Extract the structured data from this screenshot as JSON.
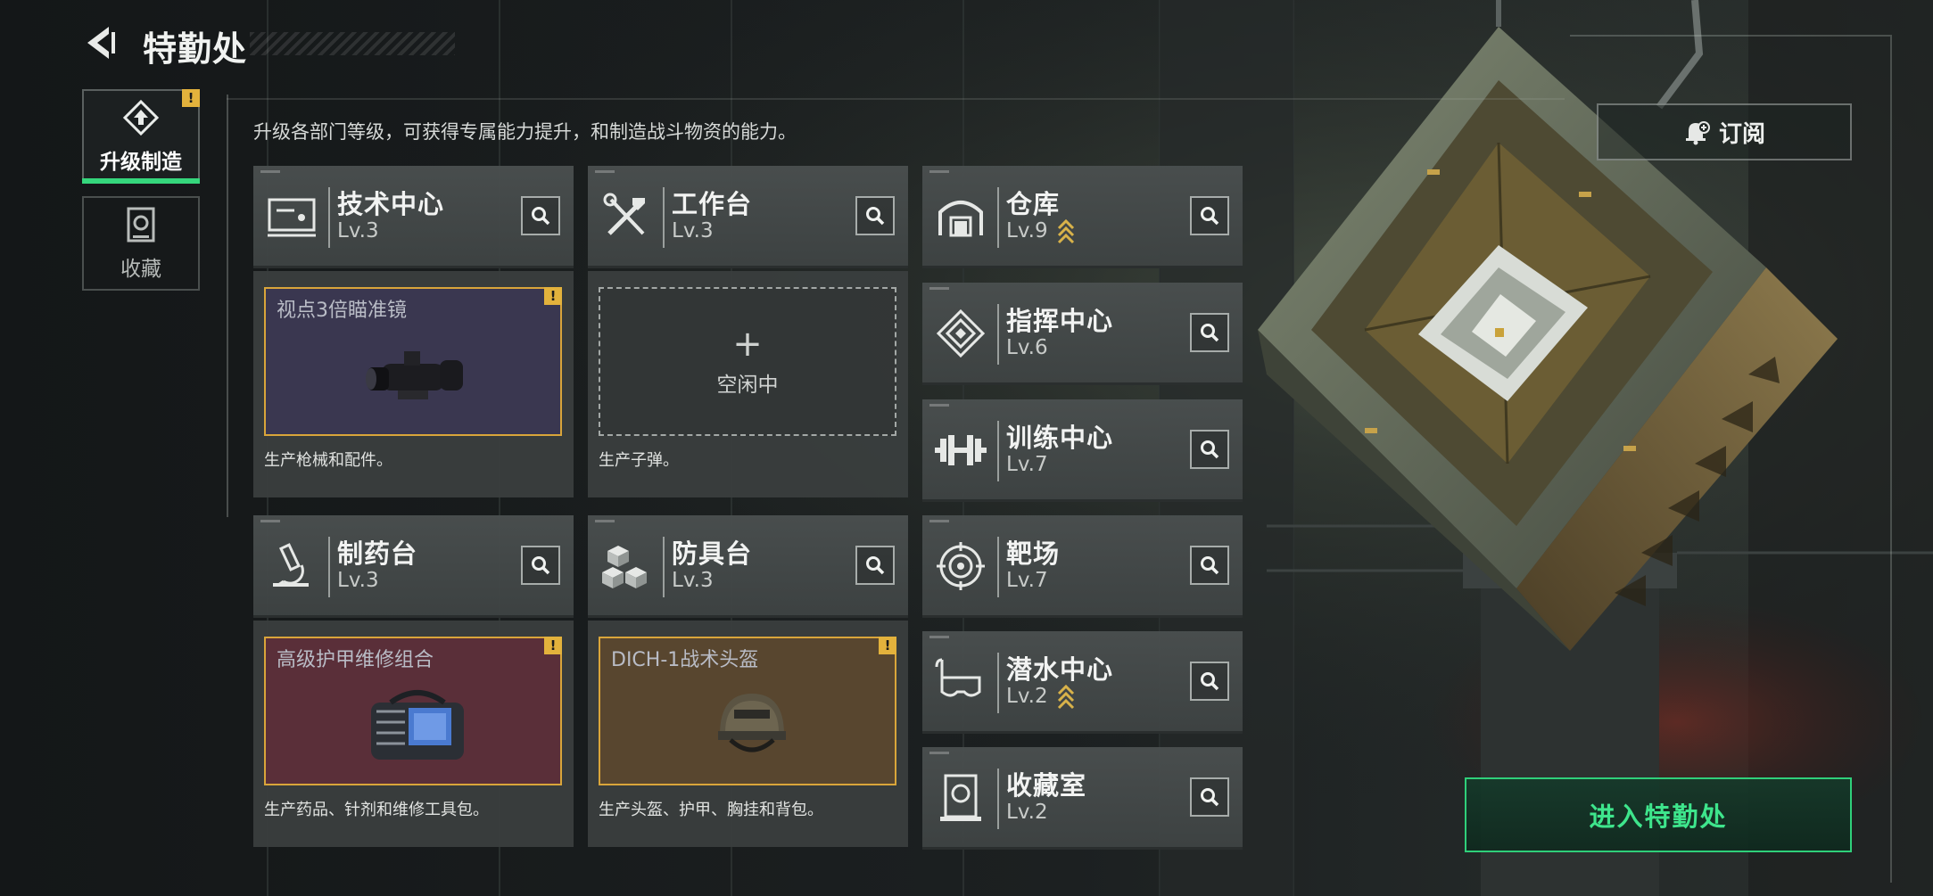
{
  "header": {
    "title": "特勤处"
  },
  "nav": {
    "tabs": [
      {
        "label": "升级制造",
        "active": true,
        "icon": "upgrade-icon",
        "warning": "!"
      },
      {
        "label": "收藏",
        "active": false,
        "icon": "collection-icon"
      }
    ]
  },
  "description": "升级各部门等级，可获得专属能力提升，和制造战斗物资的能力。",
  "facilities": {
    "tech_center": {
      "name": "技术中心",
      "level": "Lv.3",
      "icon": "terminal-icon",
      "slot": {
        "title": "视点3倍瞄准镜",
        "state": "item",
        "warning": "!",
        "art": "scope-icon"
      },
      "desc": "生产枪械和配件。"
    },
    "workbench": {
      "name": "工作台",
      "level": "Lv.3",
      "icon": "tools-icon",
      "slot": {
        "state": "idle",
        "plus": "+",
        "idle_label": "空闲中"
      },
      "desc": "生产子弹。"
    },
    "pharmacy": {
      "name": "制药台",
      "level": "Lv.3",
      "icon": "microscope-icon",
      "slot": {
        "title": "高级护甲维修组合",
        "state": "item",
        "warning": "!",
        "art": "repair-bag-icon"
      },
      "desc": "生产药品、针剂和维修工具包。"
    },
    "armory": {
      "name": "防具台",
      "level": "Lv.3",
      "icon": "cubes-icon",
      "slot": {
        "title": "DICH-1战术头盔",
        "state": "item",
        "warning": "!",
        "art": "helmet-icon"
      },
      "desc": "生产头盔、护甲、胸挂和背包。"
    },
    "warehouse": {
      "name": "仓库",
      "level": "Lv.9",
      "icon": "warehouse-icon",
      "upgradable": true
    },
    "command_center": {
      "name": "指挥中心",
      "level": "Lv.6",
      "icon": "command-icon"
    },
    "training_center": {
      "name": "训练中心",
      "level": "Lv.7",
      "icon": "dumbbell-icon"
    },
    "shooting_range": {
      "name": "靶场",
      "level": "Lv.7",
      "icon": "target-icon"
    },
    "diving_center": {
      "name": "潜水中心",
      "level": "Lv.2",
      "icon": "diving-mask-icon",
      "upgradable": true
    },
    "collection_room": {
      "name": "收藏室",
      "level": "Lv.2",
      "icon": "vault-icon"
    }
  },
  "actions": {
    "subscribe": "订阅",
    "enter": "进入特勤处"
  },
  "colors": {
    "accent_green": "#35d67c",
    "warning_yellow": "#e3b23c",
    "upgrade_gold": "#d8b24a"
  }
}
